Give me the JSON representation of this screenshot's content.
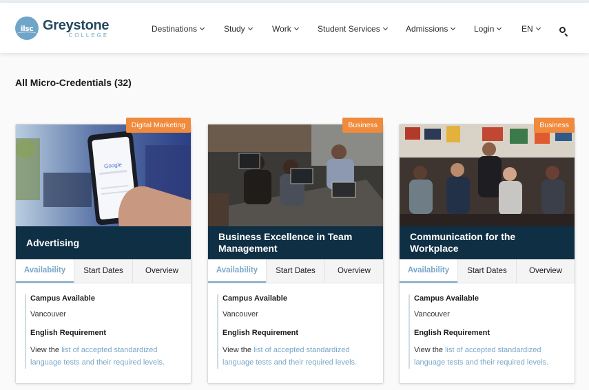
{
  "header": {
    "logo": {
      "badge_text": "ilsc",
      "name": "Greystone",
      "sub": "COLLEGE"
    },
    "nav": [
      {
        "label": "Destinations"
      },
      {
        "label": "Study"
      },
      {
        "label": "Work"
      },
      {
        "label": "Student Services"
      },
      {
        "label": "Admissions"
      },
      {
        "label": "Login"
      },
      {
        "label": "EN"
      }
    ],
    "search_icon": "search-icon"
  },
  "main": {
    "section_title": "All Micro-Credentials (32)",
    "tabs": [
      "Availability",
      "Start Dates",
      "Overview"
    ],
    "labels": {
      "campus": "Campus Available",
      "english": "English Requirement",
      "view_the": "View the ",
      "link_text": "list of accepted standardized language tests and their required levels."
    },
    "cards": [
      {
        "title": "Advertising",
        "category": "Digital Marketing",
        "campus": "Vancouver"
      },
      {
        "title": "Business Excellence in Team Management",
        "category": "Business",
        "campus": "Vancouver"
      },
      {
        "title": "Communication for the Workplace",
        "category": "Business",
        "campus": "Vancouver"
      }
    ]
  },
  "colors": {
    "accent": "#7aa7c7",
    "badge": "#f08a3c",
    "card_title_bg": "#0f2f45",
    "brand_dark": "#24485f"
  }
}
